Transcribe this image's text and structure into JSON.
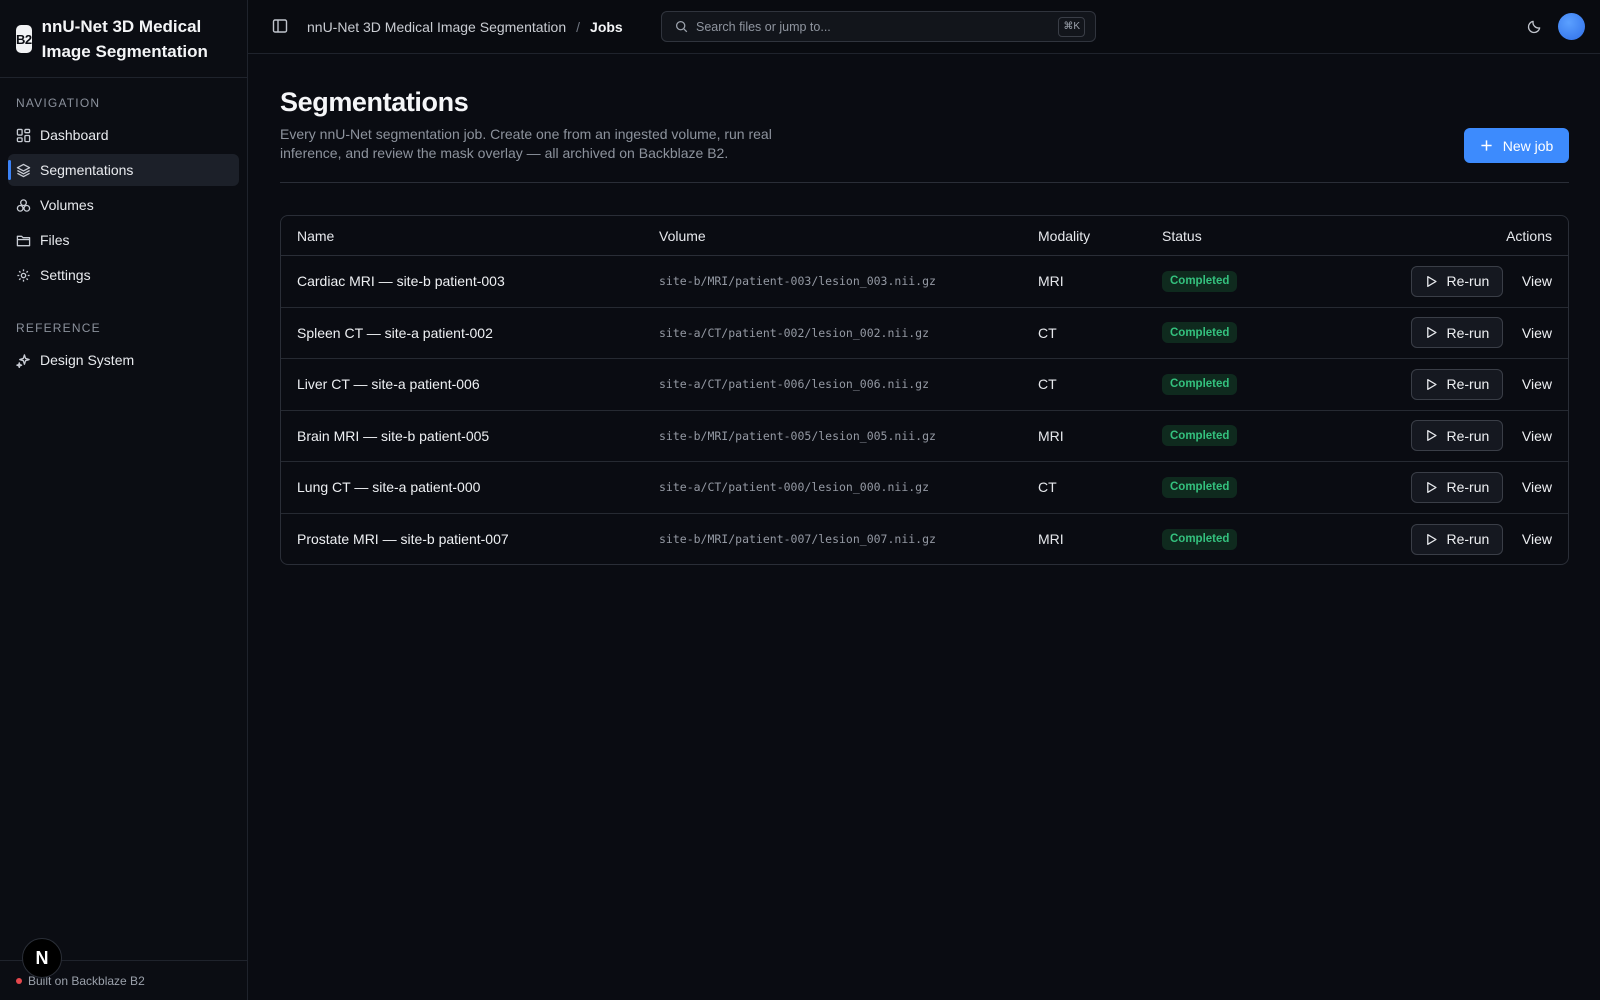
{
  "app": {
    "logo_text": "B2",
    "title": "nnU-Net 3D Medical Image Segmentation"
  },
  "sidebar": {
    "sections": [
      {
        "heading": "NAVIGATION",
        "items": [
          {
            "label": "Dashboard",
            "icon": "dashboard-icon",
            "active": false
          },
          {
            "label": "Segmentations",
            "icon": "layers-icon",
            "active": true
          },
          {
            "label": "Volumes",
            "icon": "volumes-icon",
            "active": false
          },
          {
            "label": "Files",
            "icon": "folder-icon",
            "active": false
          },
          {
            "label": "Settings",
            "icon": "gear-icon",
            "active": false
          }
        ]
      },
      {
        "heading": "REFERENCE",
        "items": [
          {
            "label": "Design System",
            "icon": "sparkles-icon",
            "active": false
          }
        ]
      }
    ],
    "footer_text": "Built on Backblaze B2",
    "dev_badge": "N"
  },
  "topbar": {
    "breadcrumb_root": "nnU-Net 3D Medical Image Segmentation",
    "breadcrumb_sep": "/",
    "breadcrumb_current": "Jobs",
    "search_placeholder": "Search files or jump to...",
    "search_shortcut": "⌘K"
  },
  "page": {
    "title": "Segmentations",
    "description": "Every nnU-Net segmentation job. Create one from an ingested volume, run real inference, and review the mask overlay — all archived on Backblaze B2.",
    "new_job_label": "New job"
  },
  "table": {
    "headers": {
      "name": "Name",
      "volume": "Volume",
      "modality": "Modality",
      "status": "Status",
      "actions": "Actions"
    },
    "rerun_label": "Re-run",
    "view_label": "View",
    "status_color": "#34c17e",
    "rows": [
      {
        "name": "Cardiac MRI — site-b patient-003",
        "volume": "site-b/MRI/patient-003/lesion_003.nii.gz",
        "modality": "MRI",
        "status": "Completed"
      },
      {
        "name": "Spleen CT — site-a patient-002",
        "volume": "site-a/CT/patient-002/lesion_002.nii.gz",
        "modality": "CT",
        "status": "Completed"
      },
      {
        "name": "Liver CT — site-a patient-006",
        "volume": "site-a/CT/patient-006/lesion_006.nii.gz",
        "modality": "CT",
        "status": "Completed"
      },
      {
        "name": "Brain MRI — site-b patient-005",
        "volume": "site-b/MRI/patient-005/lesion_005.nii.gz",
        "modality": "MRI",
        "status": "Completed"
      },
      {
        "name": "Lung CT — site-a patient-000",
        "volume": "site-a/CT/patient-000/lesion_000.nii.gz",
        "modality": "CT",
        "status": "Completed"
      },
      {
        "name": "Prostate MRI — site-b patient-007",
        "volume": "site-b/MRI/patient-007/lesion_007.nii.gz",
        "modality": "MRI",
        "status": "Completed"
      }
    ]
  },
  "colors": {
    "accent": "#3d8bfd",
    "background": "#0a0c12",
    "footer_dot": "#e5484d"
  }
}
